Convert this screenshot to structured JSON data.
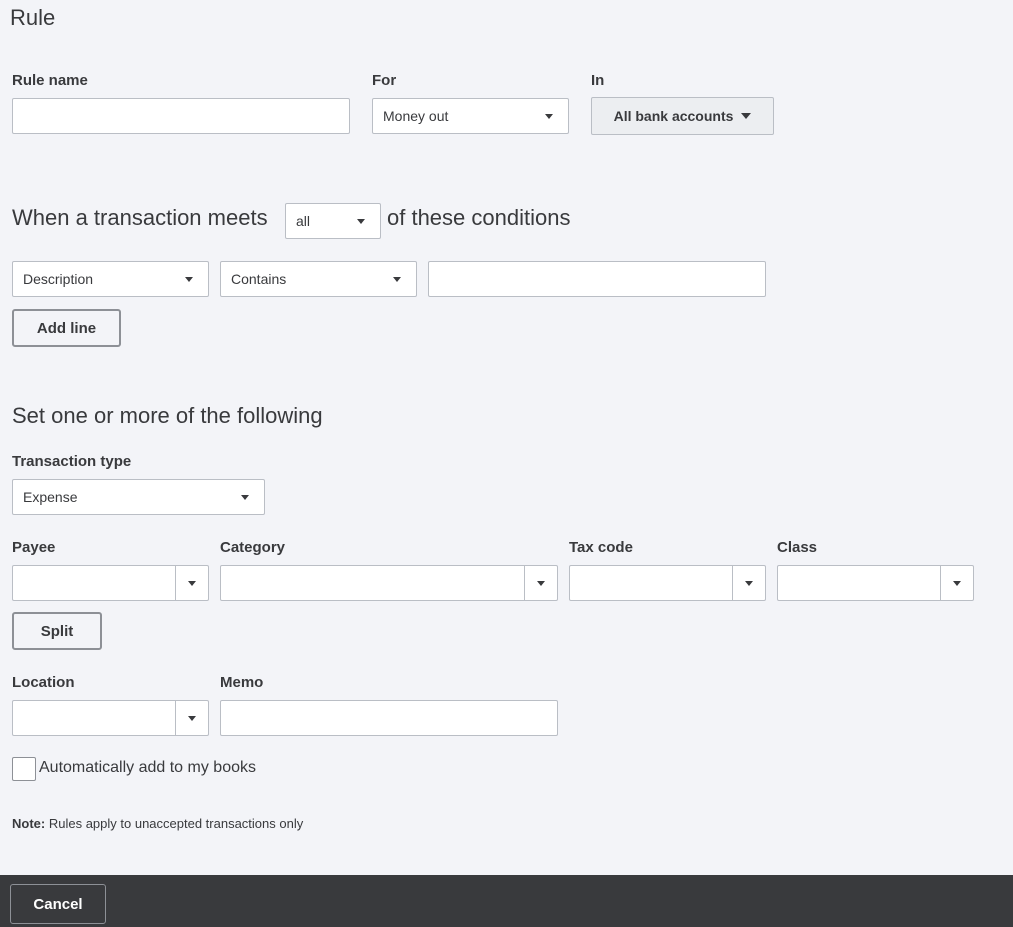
{
  "title": "Rule",
  "rule_name": {
    "label": "Rule name",
    "value": ""
  },
  "for": {
    "label": "For",
    "value": "Money out"
  },
  "in": {
    "label": "In",
    "value": "All bank accounts"
  },
  "conditions": {
    "prefix": "When a transaction meets",
    "match": "all",
    "suffix": "of these conditions",
    "field": "Description",
    "operator": "Contains",
    "text_value": "",
    "add_line_label": "Add line"
  },
  "actions": {
    "heading": "Set one or more of the following",
    "transaction_type_label": "Transaction type",
    "transaction_type_value": "Expense",
    "payee_label": "Payee",
    "category_label": "Category",
    "tax_code_label": "Tax code",
    "class_label": "Class",
    "split_label": "Split",
    "location_label": "Location",
    "memo_label": "Memo"
  },
  "auto_add_label": "Automatically add to my books",
  "note": {
    "bold": "Note:",
    "text": "Rules apply to unaccepted transactions only"
  },
  "footer": {
    "cancel_label": "Cancel"
  },
  "colors": {
    "background": "#f3f4f8",
    "footer": "#393a3d",
    "text": "#393a3d",
    "border": "#babec5"
  }
}
